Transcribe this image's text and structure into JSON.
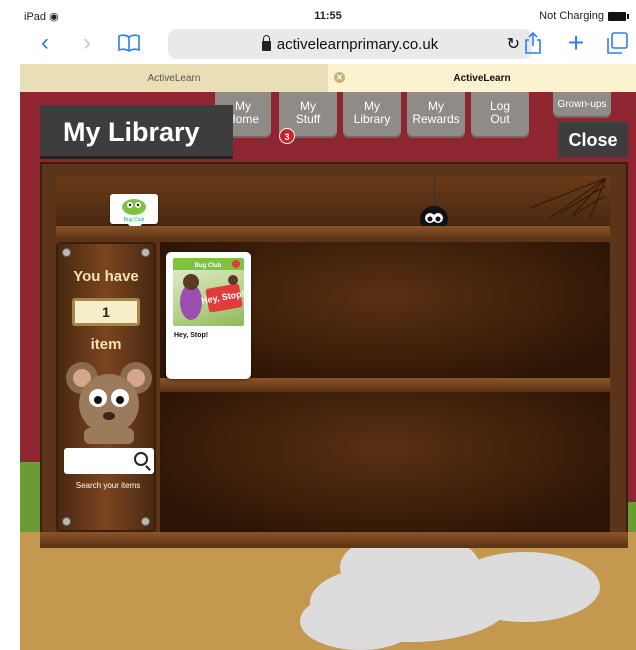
{
  "status": {
    "device": "iPad",
    "time": "11:55",
    "battery_text": "Not Charging"
  },
  "browser": {
    "url": "activelearnprimary.co.uk",
    "tabs": [
      {
        "label": "ActiveLearn",
        "active": false
      },
      {
        "label": "ActiveLearn",
        "active": true
      }
    ]
  },
  "site_nav": [
    {
      "label": "My\nHome"
    },
    {
      "label": "My\nStuff",
      "badge": "3"
    },
    {
      "label": "My\nLibrary"
    },
    {
      "label": "My\nRewards"
    },
    {
      "label": "Log\nOut"
    },
    {
      "label": "Grown-ups"
    }
  ],
  "library": {
    "title": "My Library",
    "close_label": "Close",
    "you_have": "You have",
    "item_count": "1",
    "item_label": "item",
    "search_placeholder": "",
    "search_label": "Search your items",
    "tag_label": "Bug Club",
    "books": [
      {
        "title": "Hey, Stop!",
        "cover_series": "Bug Club",
        "cover_title": "Hey, Stop!"
      }
    ]
  },
  "colors": {
    "accent": "#2f7cf6",
    "page_bg": "#8f2531",
    "nav_button": "#8f8c88",
    "title_bg": "#3d3d3d"
  }
}
